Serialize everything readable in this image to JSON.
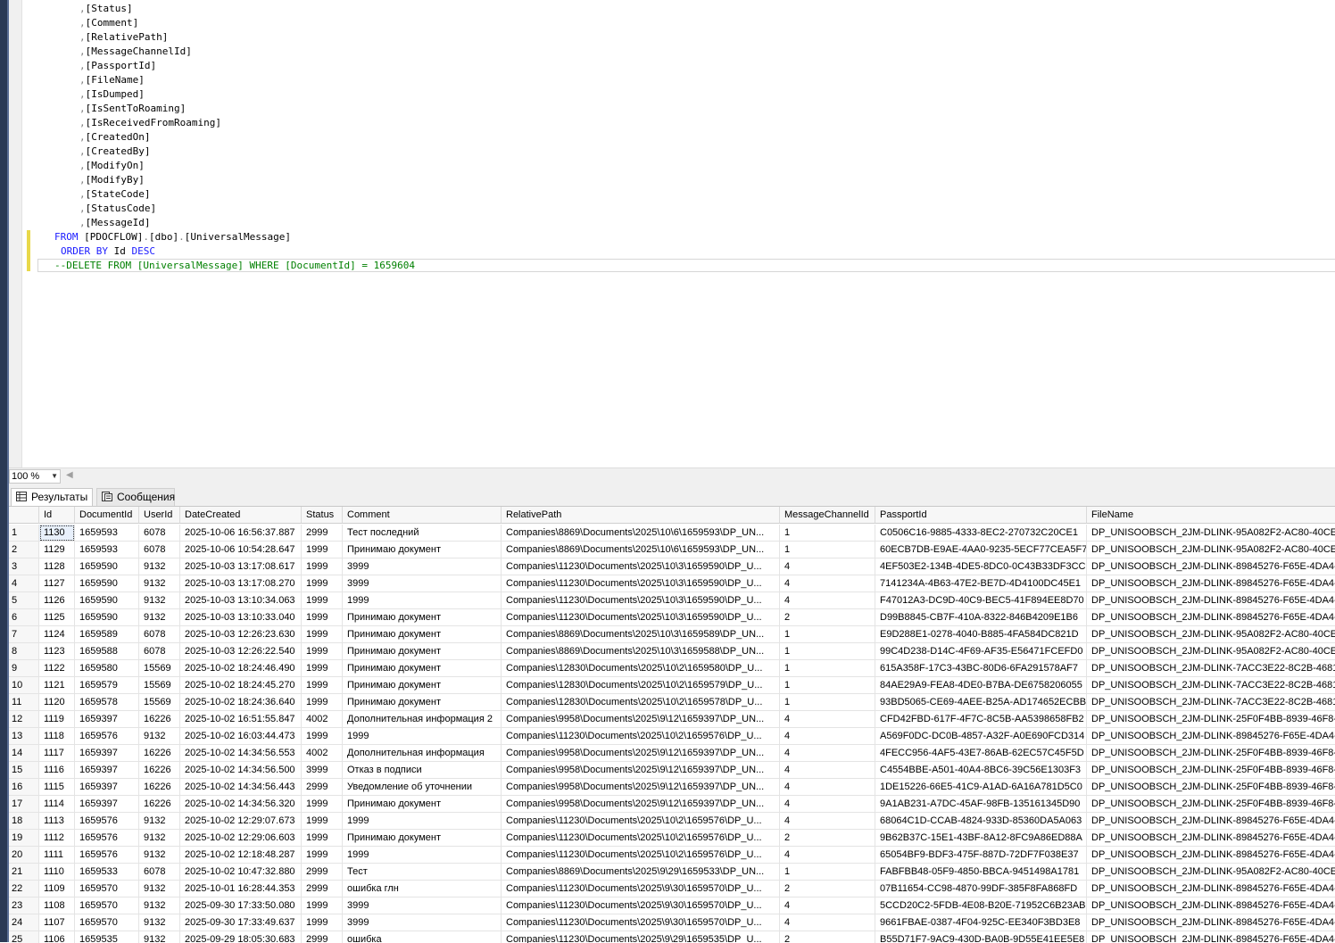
{
  "editor": {
    "lines": [
      ",[Status]",
      ",[Comment]",
      ",[RelativePath]",
      ",[MessageChannelId]",
      ",[PassportId]",
      ",[FileName]",
      ",[IsDumped]",
      ",[IsSentToRoaming]",
      ",[IsReceivedFromRoaming]",
      ",[CreatedOn]",
      ",[CreatedBy]",
      ",[ModifyOn]",
      ",[ModifyBy]",
      ",[StateCode]",
      ",[StatusCode]",
      ",[MessageId]"
    ],
    "from_keyword": "FROM",
    "from_db": "[PDOCFLOW]",
    "from_schema": "[dbo]",
    "from_table": "[UniversalMessage]",
    "dot": ".",
    "order_keyword": "ORDER BY",
    "order_column": "Id",
    "order_dir": "DESC",
    "comment_line": "--DELETE FROM [UniversalMessage] WHERE [DocumentId] = 1659604"
  },
  "zoom": {
    "value": "100 %"
  },
  "tabs": {
    "results": "Результаты",
    "messages": "Сообщения"
  },
  "grid": {
    "columns": [
      "Id",
      "DocumentId",
      "UserId",
      "DateCreated",
      "Status",
      "Comment",
      "RelativePath",
      "MessageChannelId",
      "PassportId",
      "FileName"
    ],
    "rows": [
      [
        "1",
        "1130",
        "1659593",
        "6078",
        "2025-10-06 16:56:37.887",
        "2999",
        "Тест последний",
        "Companies\\8869\\Documents\\2025\\10\\6\\1659593\\DP_UN...",
        "1",
        "C0506C16-9885-4333-8EC2-270732C20CE1",
        "DP_UNISOOBSCH_2JM-DLINK-95A082F2-AC80-40CE-"
      ],
      [
        "2",
        "1129",
        "1659593",
        "6078",
        "2025-10-06 10:54:28.647",
        "1999",
        "Принимаю документ",
        "Companies\\8869\\Documents\\2025\\10\\6\\1659593\\DP_UN...",
        "1",
        "60ECB7DB-E9AE-4AA0-9235-5ECF77CEA5F7",
        "DP_UNISOOBSCH_2JM-DLINK-95A082F2-AC80-40CE-"
      ],
      [
        "3",
        "1128",
        "1659590",
        "9132",
        "2025-10-03 13:17:08.617",
        "1999",
        "3999",
        "Companies\\11230\\Documents\\2025\\10\\3\\1659590\\DP_U...",
        "4",
        "4EF503E2-134B-4DE5-8DC0-0C43B33DF3CC",
        "DP_UNISOOBSCH_2JM-DLINK-89845276-F65E-4DA4-"
      ],
      [
        "4",
        "1127",
        "1659590",
        "9132",
        "2025-10-03 13:17:08.270",
        "1999",
        "3999",
        "Companies\\11230\\Documents\\2025\\10\\3\\1659590\\DP_U...",
        "4",
        "7141234A-4B63-47E2-BE7D-4D4100DC45E1",
        "DP_UNISOOBSCH_2JM-DLINK-89845276-F65E-4DA4-"
      ],
      [
        "5",
        "1126",
        "1659590",
        "9132",
        "2025-10-03 13:10:34.063",
        "1999",
        "1999",
        "Companies\\11230\\Documents\\2025\\10\\3\\1659590\\DP_U...",
        "4",
        "F47012A3-DC9D-40C9-BEC5-41F894EE8D70",
        "DP_UNISOOBSCH_2JM-DLINK-89845276-F65E-4DA4-"
      ],
      [
        "6",
        "1125",
        "1659590",
        "9132",
        "2025-10-03 13:10:33.040",
        "1999",
        "Принимаю документ",
        "Companies\\11230\\Documents\\2025\\10\\3\\1659590\\DP_U...",
        "2",
        "D99B8845-CB7F-410A-8322-846B4209E1B6",
        "DP_UNISOOBSCH_2JM-DLINK-89845276-F65E-4DA4-"
      ],
      [
        "7",
        "1124",
        "1659589",
        "6078",
        "2025-10-03 12:26:23.630",
        "1999",
        "Принимаю документ",
        "Companies\\8869\\Documents\\2025\\10\\3\\1659589\\DP_UN...",
        "1",
        "E9D288E1-0278-4040-B885-4FA584DC821D",
        "DP_UNISOOBSCH_2JM-DLINK-95A082F2-AC80-40CE-"
      ],
      [
        "8",
        "1123",
        "1659588",
        "6078",
        "2025-10-03 12:26:22.540",
        "1999",
        "Принимаю документ",
        "Companies\\8869\\Documents\\2025\\10\\3\\1659588\\DP_UN...",
        "1",
        "99C4D238-D14C-4F69-AF35-E56471FCEFD0",
        "DP_UNISOOBSCH_2JM-DLINK-95A082F2-AC80-40CE-"
      ],
      [
        "9",
        "1122",
        "1659580",
        "15569",
        "2025-10-02 18:24:46.490",
        "1999",
        "Принимаю документ",
        "Companies\\12830\\Documents\\2025\\10\\2\\1659580\\DP_U...",
        "1",
        "615A358F-17C3-43BC-80D6-6FA291578AF7",
        "DP_UNISOOBSCH_2JM-DLINK-7ACC3E22-8C2B-4681-"
      ],
      [
        "10",
        "1121",
        "1659579",
        "15569",
        "2025-10-02 18:24:45.270",
        "1999",
        "Принимаю документ",
        "Companies\\12830\\Documents\\2025\\10\\2\\1659579\\DP_U...",
        "1",
        "84AE29A9-FEA8-4DE0-B7BA-DE6758206055",
        "DP_UNISOOBSCH_2JM-DLINK-7ACC3E22-8C2B-4681-"
      ],
      [
        "11",
        "1120",
        "1659578",
        "15569",
        "2025-10-02 18:24:36.640",
        "1999",
        "Принимаю документ",
        "Companies\\12830\\Documents\\2025\\10\\2\\1659578\\DP_U...",
        "1",
        "93BD5065-CE69-4AEE-B25A-AD174652ECBB",
        "DP_UNISOOBSCH_2JM-DLINK-7ACC3E22-8C2B-4681-"
      ],
      [
        "12",
        "1119",
        "1659397",
        "16226",
        "2025-10-02 16:51:55.847",
        "4002",
        "Дополнительная информация 2",
        "Companies\\9958\\Documents\\2025\\9\\12\\1659397\\DP_UN...",
        "4",
        "CFD42FBD-617F-4F7C-8C5B-AA5398658FB2",
        "DP_UNISOOBSCH_2JM-DLINK-25F0F4BB-8939-46F8-"
      ],
      [
        "13",
        "1118",
        "1659576",
        "9132",
        "2025-10-02 16:03:44.473",
        "1999",
        "1999",
        "Companies\\11230\\Documents\\2025\\10\\2\\1659576\\DP_U...",
        "4",
        "A569F0DC-DC0B-4857-A32F-A0E690FCD314",
        "DP_UNISOOBSCH_2JM-DLINK-89845276-F65E-4DA4-"
      ],
      [
        "14",
        "1117",
        "1659397",
        "16226",
        "2025-10-02 14:34:56.553",
        "4002",
        "Дополнительная информация",
        "Companies\\9958\\Documents\\2025\\9\\12\\1659397\\DP_UN...",
        "4",
        "4FECC956-4AF5-43E7-86AB-62EC57C45F5D",
        "DP_UNISOOBSCH_2JM-DLINK-25F0F4BB-8939-46F8-"
      ],
      [
        "15",
        "1116",
        "1659397",
        "16226",
        "2025-10-02 14:34:56.500",
        "3999",
        "Отказ в подписи",
        "Companies\\9958\\Documents\\2025\\9\\12\\1659397\\DP_UN...",
        "4",
        "C4554BBE-A501-40A4-8BC6-39C56E1303F3",
        "DP_UNISOOBSCH_2JM-DLINK-25F0F4BB-8939-46F8-"
      ],
      [
        "16",
        "1115",
        "1659397",
        "16226",
        "2025-10-02 14:34:56.443",
        "2999",
        "Уведомление об уточнении",
        "Companies\\9958\\Documents\\2025\\9\\12\\1659397\\DP_UN...",
        "4",
        "1DE15226-66E5-41C9-A1AD-6A16A781D5C0",
        "DP_UNISOOBSCH_2JM-DLINK-25F0F4BB-8939-46F8-"
      ],
      [
        "17",
        "1114",
        "1659397",
        "16226",
        "2025-10-02 14:34:56.320",
        "1999",
        "Принимаю документ",
        "Companies\\9958\\Documents\\2025\\9\\12\\1659397\\DP_UN...",
        "4",
        "9A1AB231-A7DC-45AF-98FB-135161345D90",
        "DP_UNISOOBSCH_2JM-DLINK-25F0F4BB-8939-46F8-"
      ],
      [
        "18",
        "1113",
        "1659576",
        "9132",
        "2025-10-02 12:29:07.673",
        "1999",
        "1999",
        "Companies\\11230\\Documents\\2025\\10\\2\\1659576\\DP_U...",
        "4",
        "68064C1D-CCAB-4824-933D-85360DA5A063",
        "DP_UNISOOBSCH_2JM-DLINK-89845276-F65E-4DA4-"
      ],
      [
        "19",
        "1112",
        "1659576",
        "9132",
        "2025-10-02 12:29:06.603",
        "1999",
        "Принимаю документ",
        "Companies\\11230\\Documents\\2025\\10\\2\\1659576\\DP_U...",
        "2",
        "9B62B37C-15E1-43BF-8A12-8FC9A86ED88A",
        "DP_UNISOOBSCH_2JM-DLINK-89845276-F65E-4DA4-"
      ],
      [
        "20",
        "1111",
        "1659576",
        "9132",
        "2025-10-02 12:18:48.287",
        "1999",
        "1999",
        "Companies\\11230\\Documents\\2025\\10\\2\\1659576\\DP_U...",
        "4",
        "65054BF9-BDF3-475F-887D-72DF7F038E37",
        "DP_UNISOOBSCH_2JM-DLINK-89845276-F65E-4DA4-"
      ],
      [
        "21",
        "1110",
        "1659533",
        "6078",
        "2025-10-02 10:47:32.880",
        "2999",
        "Тест",
        "Companies\\8869\\Documents\\2025\\9\\29\\1659533\\DP_UN...",
        "1",
        "FABFBB48-05F9-4850-BBCA-9451498A1781",
        "DP_UNISOOBSCH_2JM-DLINK-95A082F2-AC80-40CE-"
      ],
      [
        "22",
        "1109",
        "1659570",
        "9132",
        "2025-10-01 16:28:44.353",
        "2999",
        "ошибка глн",
        "Companies\\11230\\Documents\\2025\\9\\30\\1659570\\DP_U...",
        "2",
        "07B11654-CC98-4870-99DF-385F8FA868FD",
        "DP_UNISOOBSCH_2JM-DLINK-89845276-F65E-4DA4-"
      ],
      [
        "23",
        "1108",
        "1659570",
        "9132",
        "2025-09-30 17:33:50.080",
        "1999",
        "3999",
        "Companies\\11230\\Documents\\2025\\9\\30\\1659570\\DP_U...",
        "4",
        "5CCD20C2-5FDB-4E08-B20E-71952C6B23AB",
        "DP_UNISOOBSCH_2JM-DLINK-89845276-F65E-4DA4-"
      ],
      [
        "24",
        "1107",
        "1659570",
        "9132",
        "2025-09-30 17:33:49.637",
        "1999",
        "3999",
        "Companies\\11230\\Documents\\2025\\9\\30\\1659570\\DP_U...",
        "4",
        "9661FBAE-0387-4F04-925C-EE340F3BD3E8",
        "DP_UNISOOBSCH_2JM-DLINK-89845276-F65E-4DA4-"
      ],
      [
        "25",
        "1106",
        "1659535",
        "9132",
        "2025-09-29 18:05:30.683",
        "2999",
        "ошибка",
        "Companies\\11230\\Documents\\2025\\9\\29\\1659535\\DP_U...",
        "2",
        "B55D71F7-9AC9-430D-BA0B-9D55E41EE5E8",
        "DP_UNISOOBSCH_2JM-DLINK-89845276-F65E-4DA4-"
      ]
    ]
  }
}
